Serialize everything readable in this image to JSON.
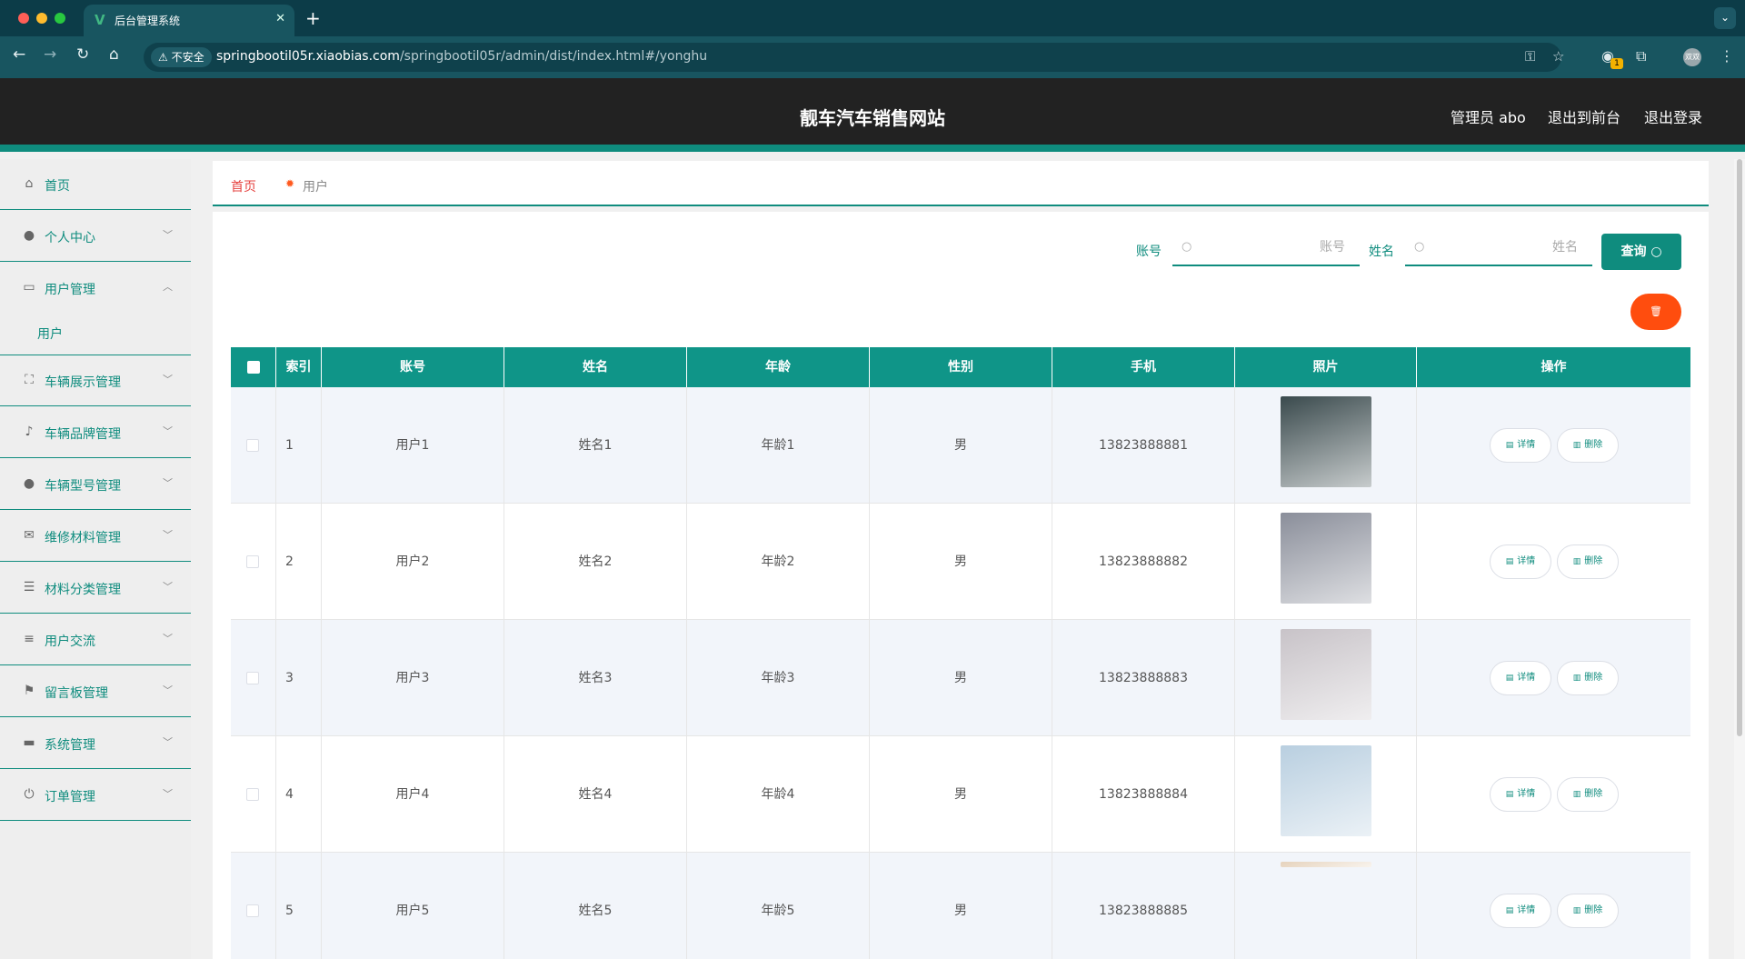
{
  "browser": {
    "tab_title": "后台管理系统",
    "tab_favicon": "V",
    "new_tab": "+",
    "insecure_label": "不安全",
    "url_host": "springbootil05r.xiaobias.com",
    "url_path": "/springbootil05r/admin/dist/index.html#/yonghu",
    "extension_badge": "1",
    "profile_label": "双双",
    "colors": {
      "tabbar": "#0c3c48",
      "toolbar": "#185560",
      "traffic_red": "#ff5f57",
      "traffic_yellow": "#febc2e",
      "traffic_green": "#28c840"
    }
  },
  "header": {
    "title": "靓车汽车销售网站",
    "admin_label": "管理员 abo",
    "to_front": "退出到前台",
    "logout": "退出登录",
    "colors": {
      "background": "#222222",
      "accent": "#0f8c7e"
    }
  },
  "sidebar": {
    "items": [
      {
        "label": "首页",
        "icon": "home-icon",
        "glyph": "⌂",
        "arrow": ""
      },
      {
        "label": "个人中心",
        "icon": "user-icon",
        "glyph": "●",
        "arrow": "﹀"
      },
      {
        "label": "用户管理",
        "icon": "chat-icon",
        "glyph": "▭",
        "arrow": "︿"
      },
      {
        "label": "车辆展示管理",
        "icon": "fullscreen-icon",
        "glyph": "⛶",
        "arrow": "﹀"
      },
      {
        "label": "车辆品牌管理",
        "icon": "bell-off-icon",
        "glyph": "♪",
        "arrow": "﹀"
      },
      {
        "label": "车辆型号管理",
        "icon": "bulb-icon",
        "glyph": "●",
        "arrow": "﹀"
      },
      {
        "label": "维修材料管理",
        "icon": "mail-icon",
        "glyph": "✉",
        "arrow": "﹀"
      },
      {
        "label": "材料分类管理",
        "icon": "menu-icon",
        "glyph": "☰",
        "arrow": "﹀"
      },
      {
        "label": "用户交流",
        "icon": "sliders-icon",
        "glyph": "≡",
        "arrow": "﹀"
      },
      {
        "label": "留言板管理",
        "icon": "flag-icon",
        "glyph": "⚑",
        "arrow": "﹀"
      },
      {
        "label": "系统管理",
        "icon": "brush-icon",
        "glyph": "▬",
        "arrow": "﹀"
      },
      {
        "label": "订单管理",
        "icon": "power-icon",
        "glyph": "⏻",
        "arrow": "﹀"
      }
    ],
    "sub_item": "用户"
  },
  "breadcrumb": {
    "home": "首页",
    "separator": "✹",
    "current": "用户"
  },
  "search": {
    "account_label": "账号",
    "account_value": "",
    "account_placeholder": "账号",
    "name_label": "姓名",
    "name_value": "",
    "name_placeholder": "姓名",
    "query_label": "查询",
    "query_icon": "search-icon"
  },
  "table": {
    "columns": [
      "索引",
      "账号",
      "姓名",
      "年龄",
      "性别",
      "手机",
      "照片",
      "操作"
    ],
    "detail_label": "详情",
    "delete_label": "删除",
    "rows": [
      {
        "index": "1",
        "account": "用户1",
        "name": "姓名1",
        "age": "年龄1",
        "gender": "男",
        "phone": "13823888881",
        "photo_color": "#3a4a4d"
      },
      {
        "index": "2",
        "account": "用户2",
        "name": "姓名2",
        "age": "年龄2",
        "gender": "男",
        "phone": "13823888882",
        "photo_color": "#8a8e9a"
      },
      {
        "index": "3",
        "account": "用户3",
        "name": "姓名3",
        "age": "年龄3",
        "gender": "男",
        "phone": "13823888883",
        "photo_color": "#c8c3c8"
      },
      {
        "index": "4",
        "account": "用户4",
        "name": "姓名4",
        "age": "年龄4",
        "gender": "男",
        "phone": "13823888884",
        "photo_color": "#b9cfe0"
      },
      {
        "index": "5",
        "account": "用户5",
        "name": "姓名5",
        "age": "年龄5",
        "gender": "男",
        "phone": "13823888885",
        "photo_color": "#e6d3bd"
      }
    ],
    "colors": {
      "header": "#0f9588",
      "odd_row": "#f2f5fa",
      "delete_button": "#ff4d0e"
    }
  }
}
